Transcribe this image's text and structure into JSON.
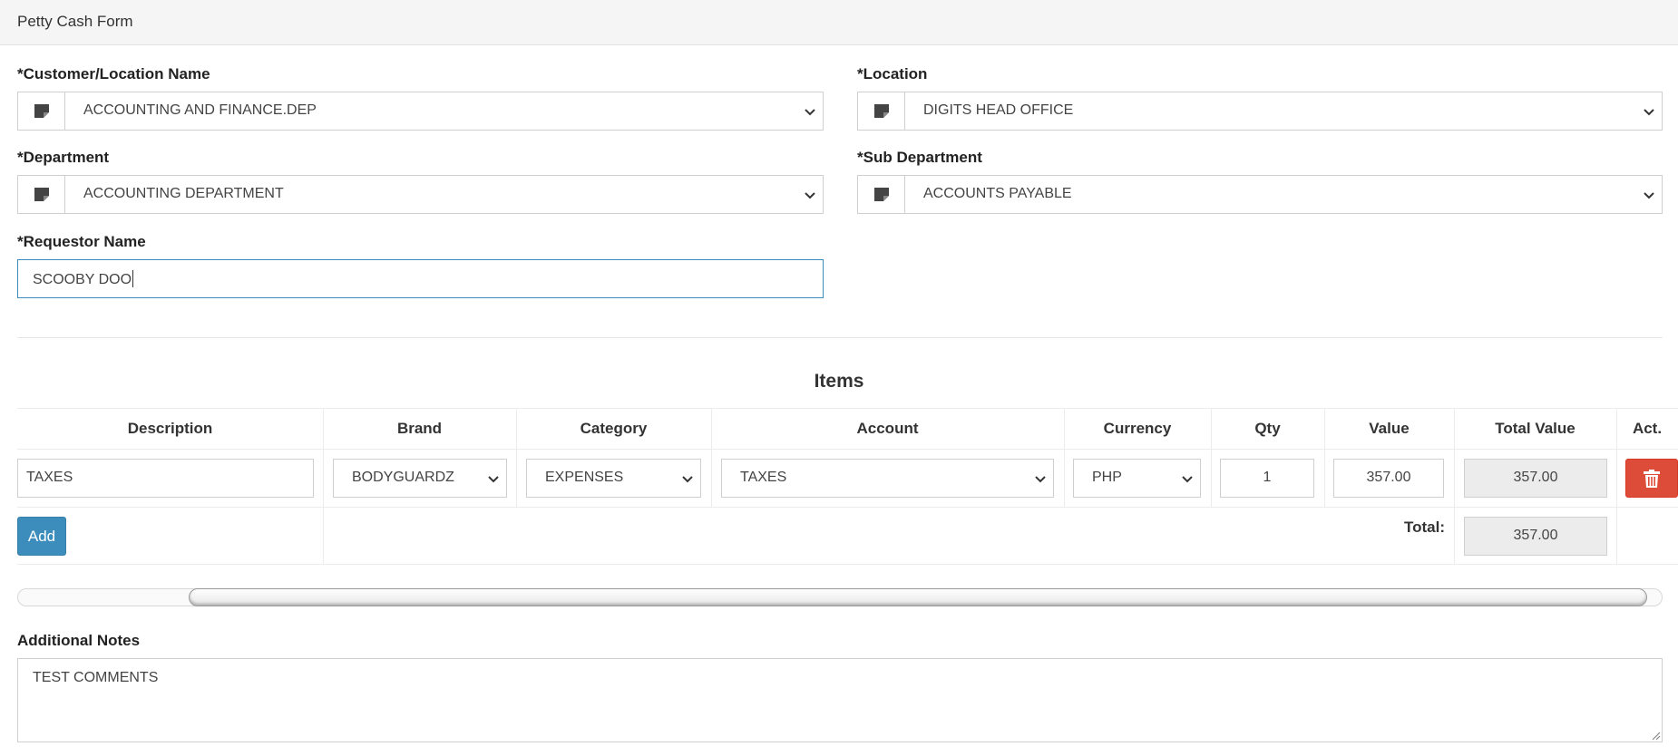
{
  "header": {
    "title": "Petty Cash Form"
  },
  "form": {
    "customer": {
      "label": "*Customer/Location Name",
      "value": "ACCOUNTING AND FINANCE.DEP"
    },
    "location": {
      "label": "*Location",
      "value": "DIGITS HEAD OFFICE"
    },
    "department": {
      "label": "*Department",
      "value": "ACCOUNTING DEPARTMENT"
    },
    "sub_department": {
      "label": "*Sub Department",
      "value": "ACCOUNTS PAYABLE"
    },
    "requestor": {
      "label": "*Requestor Name",
      "value": "SCOOBY DOO"
    }
  },
  "items": {
    "title": "Items",
    "columns": [
      "Description",
      "Brand",
      "Category",
      "Account",
      "Currency",
      "Qty",
      "Value",
      "Total Value",
      "Act."
    ],
    "rows": [
      {
        "description": "TAXES",
        "brand": "BODYGUARDZ",
        "category": "EXPENSES",
        "account": "TAXES",
        "currency": "PHP",
        "qty": "1",
        "value": "357.00",
        "total_value": "357.00"
      }
    ],
    "add_label": "Add",
    "total_label": "Total:",
    "total_value": "357.00"
  },
  "notes": {
    "label": "Additional Notes",
    "value": "TEST COMMENTS"
  },
  "colors": {
    "primary": "#3c8dbc",
    "danger": "#dd4b39",
    "header_bg": "#f5f5f5"
  }
}
